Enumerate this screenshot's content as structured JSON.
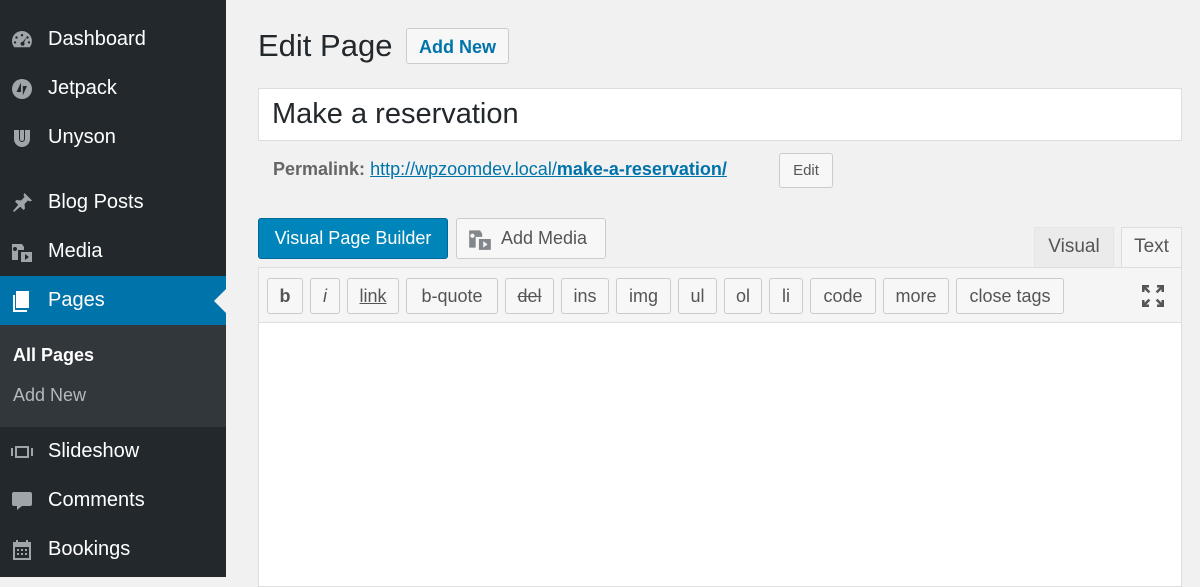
{
  "sidebar": {
    "items": [
      {
        "label": "Dashboard",
        "icon": "dashboard-icon"
      },
      {
        "label": "Jetpack",
        "icon": "jetpack-icon"
      },
      {
        "label": "Unyson",
        "icon": "unyson-icon"
      },
      {
        "label": "Blog Posts",
        "icon": "pin-icon"
      },
      {
        "label": "Media",
        "icon": "media-icon"
      },
      {
        "label": "Pages",
        "icon": "pages-icon",
        "active": true
      },
      {
        "label": "Slideshow",
        "icon": "slideshow-icon"
      },
      {
        "label": "Comments",
        "icon": "comments-icon"
      },
      {
        "label": "Bookings",
        "icon": "calendar-icon"
      }
    ],
    "submenu": [
      {
        "label": "All Pages",
        "current": true
      },
      {
        "label": "Add New"
      }
    ]
  },
  "header": {
    "title": "Edit Page",
    "add_new_label": "Add New"
  },
  "editor": {
    "title_value": "Make a reservation",
    "permalink_label": "Permalink:",
    "permalink_base": "http://wpzoomdev.local/",
    "permalink_slug": "make-a-reservation/",
    "edit_slug_label": "Edit",
    "visual_page_builder_label": "Visual Page Builder",
    "add_media_label": "Add Media",
    "tabs": {
      "visual": "Visual",
      "text": "Text"
    },
    "quicktags": [
      "b",
      "i",
      "link",
      "b-quote",
      "del",
      "ins",
      "img",
      "ul",
      "ol",
      "li",
      "code",
      "more",
      "close tags"
    ],
    "content": ""
  },
  "colors": {
    "sidebar_bg": "#23282d",
    "active_bg": "#0073aa",
    "primary_button": "#0085ba",
    "link": "#0073aa"
  }
}
